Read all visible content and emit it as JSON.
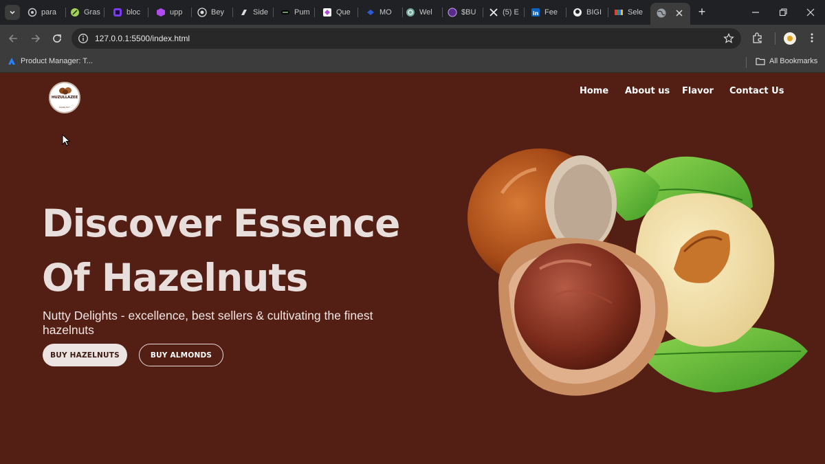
{
  "browser": {
    "tabs": [
      {
        "label": "para",
        "icon": "openai-icon"
      },
      {
        "label": "Gras",
        "icon": "grass-icon"
      },
      {
        "label": "bloc",
        "icon": "block-icon"
      },
      {
        "label": "upp",
        "icon": "cube-icon"
      },
      {
        "label": "Bey",
        "icon": "beyond-icon"
      },
      {
        "label": "Side",
        "icon": "sideshift-icon"
      },
      {
        "label": "Pum",
        "icon": "pump-icon"
      },
      {
        "label": "Que",
        "icon": "quest-icon"
      },
      {
        "label": "MO",
        "icon": "mo-icon"
      },
      {
        "label": "Wel",
        "icon": "chatgpt-icon"
      },
      {
        "label": "$BU",
        "icon": "token-icon"
      },
      {
        "label": "(5) E",
        "icon": "x-icon"
      },
      {
        "label": "Fee",
        "icon": "linkedin-icon"
      },
      {
        "label": "BIGI",
        "icon": "github-icon"
      },
      {
        "label": "Sele",
        "icon": "zoho-icon"
      }
    ],
    "active_tab_icon": "globe-icon",
    "new_tab_label": "+",
    "url": "127.0.0.1:5500/index.html",
    "bookmarks": [
      {
        "label": "Product Manager: T...",
        "icon": "atlassian-icon"
      }
    ],
    "all_bookmarks_label": "All Bookmarks"
  },
  "site": {
    "logo_text": "HUZULLAZEE",
    "logo_sub": "HAZELNUT",
    "nav": [
      "Home",
      "About us",
      "Flavor",
      "Contact Us"
    ],
    "hero": {
      "title_line1": "Discover Essence",
      "title_line2": "Of Hazelnuts",
      "subtitle": "Nutty Delights - excellence, best sellers & cultivating the finest hazelnuts",
      "primary_button": "BUY HAZELNUTS",
      "secondary_button": "BUY ALMONDS"
    }
  },
  "colors": {
    "page_bg": "#531e13",
    "title_text": "#e8dedc",
    "button_light": "#ece4e2",
    "browser_chrome": "#3c3c3c"
  }
}
